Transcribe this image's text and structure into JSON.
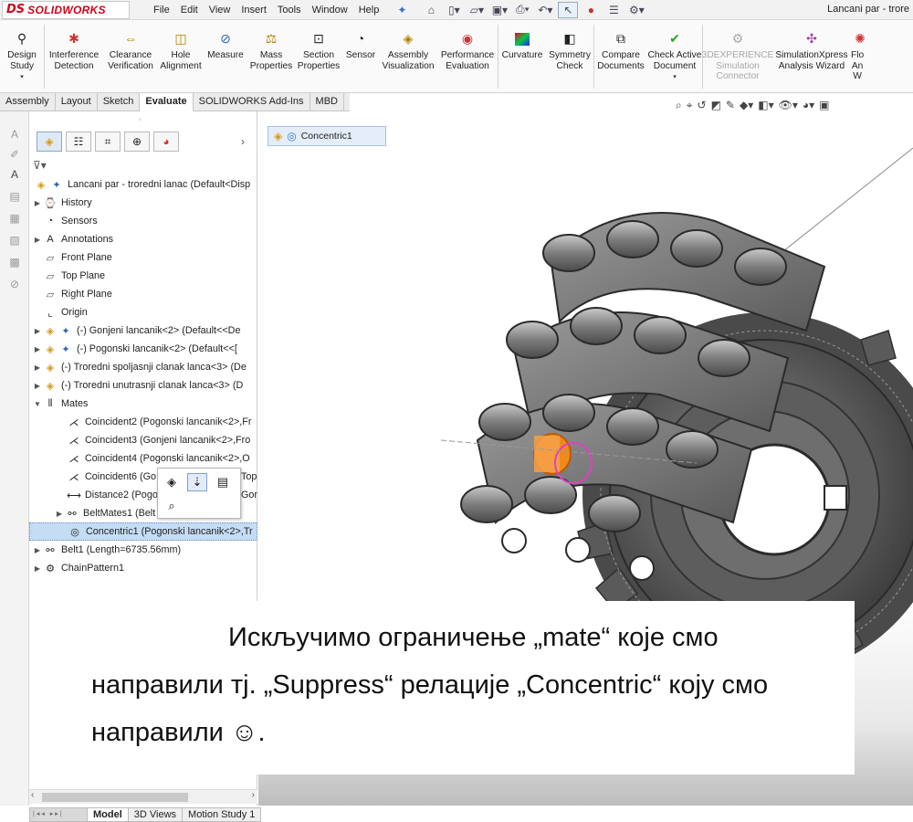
{
  "app": {
    "logo_ds": "DS",
    "logo_name": "SOLIDWORKS",
    "document_title": "Lancani par - trore"
  },
  "menu": [
    "File",
    "Edit",
    "View",
    "Insert",
    "Tools",
    "Window",
    "Help"
  ],
  "command_manager": [
    {
      "label": "Design Study",
      "icon": "design-study-icon",
      "has_dropdown": true
    },
    {
      "label": "Interference Detection",
      "icon": "interference-detection-icon"
    },
    {
      "label": "Clearance Verification",
      "icon": "clearance-verification-icon"
    },
    {
      "label": "Hole Alignment",
      "icon": "hole-alignment-icon"
    },
    {
      "label": "Measure",
      "icon": "measure-icon"
    },
    {
      "label": "Mass Properties",
      "icon": "mass-properties-icon"
    },
    {
      "label": "Section Properties",
      "icon": "section-properties-icon"
    },
    {
      "label": "Sensor",
      "icon": "sensor-icon"
    },
    {
      "label": "Assembly Visualization",
      "icon": "assembly-visualization-icon"
    },
    {
      "label": "Performance Evaluation",
      "icon": "performance-evaluation-icon"
    },
    {
      "label": "Curvature",
      "icon": "curvature-icon"
    },
    {
      "label": "Symmetry Check",
      "icon": "symmetry-check-icon"
    },
    {
      "label": "Compare Documents",
      "icon": "compare-documents-icon"
    },
    {
      "label": "Check Active Document",
      "icon": "check-active-document-icon",
      "has_dropdown": true
    },
    {
      "label": "3DEXPERIENCE Simulation Connector",
      "icon": "3dexperience-icon",
      "disabled": true
    },
    {
      "label": "SimulationXpress Analysis Wizard",
      "icon": "simulationxpress-icon"
    },
    {
      "label": "Flo An W",
      "icon": "flow-analysis-icon"
    }
  ],
  "command_tabs": [
    {
      "label": "Assembly"
    },
    {
      "label": "Layout"
    },
    {
      "label": "Sketch"
    },
    {
      "label": "Evaluate",
      "active": true
    },
    {
      "label": "SOLIDWORKS Add-Ins"
    },
    {
      "label": "MBD"
    }
  ],
  "feature_tree": {
    "root": "Lancani par - troredni lanac  (Default<Disp",
    "items": [
      {
        "label": "History",
        "icon": "history-icon",
        "expandable": true
      },
      {
        "label": "Sensors",
        "icon": "sensors-icon"
      },
      {
        "label": "Annotations",
        "icon": "annotations-icon",
        "expandable": true
      },
      {
        "label": "Front Plane",
        "icon": "plane-icon"
      },
      {
        "label": "Top Plane",
        "icon": "plane-icon"
      },
      {
        "label": "Right Plane",
        "icon": "plane-icon"
      },
      {
        "label": "Origin",
        "icon": "origin-icon"
      },
      {
        "label": "(-) Gonjeni lancanik<2> (Default<<De",
        "icon": "part-icon",
        "expandable": true
      },
      {
        "label": "(-) Pogonski lancanik<2> (Default<<[",
        "icon": "part-icon",
        "expandable": true
      },
      {
        "label": "(-) Troredni spoljasnji clanak lanca<3> (De",
        "icon": "part-icon",
        "expandable": true
      },
      {
        "label": "(-) Troredni unutrasnji clanak lanca<3> (D",
        "icon": "part-icon",
        "expandable": true
      },
      {
        "label": "Mates",
        "icon": "mates-icon",
        "expanded": true
      },
      {
        "label": "Coincident2 (Pogonski lancanik<2>,Fr",
        "icon": "coincident-icon",
        "indent": 1
      },
      {
        "label": "Coincident3 (Gonjeni lancanik<2>,Fro",
        "icon": "coincident-icon",
        "indent": 1
      },
      {
        "label": "Coincident4 (Pogonski lancanik<2>,O",
        "icon": "coincident-icon",
        "indent": 1
      },
      {
        "label": "Coincident6 (Go",
        "icon": "coincident-icon",
        "indent": 1,
        "tail": "Top"
      },
      {
        "label": "Distance2 (Pogo",
        "icon": "distance-icon",
        "indent": 1,
        "tail": "Gon"
      },
      {
        "label": "BeltMates1 (Belt",
        "icon": "beltmates-icon",
        "indent": 1,
        "expandable": true
      },
      {
        "label": "Concentric1 (Pogonski lancanik<2>,Tr",
        "icon": "concentric-icon",
        "indent": 1,
        "selected": true
      },
      {
        "label": "Belt1 (Length=6735.56mm)",
        "icon": "belt-icon",
        "expandable": true
      },
      {
        "label": "ChainPattern1",
        "icon": "chain-pattern-icon",
        "expandable": true
      }
    ]
  },
  "breadcrumb": {
    "label": "Concentric1"
  },
  "bottom_tabs": [
    {
      "label": "Model",
      "active": true
    },
    {
      "label": "3D Views"
    },
    {
      "label": "Motion Study 1"
    }
  ],
  "caption": {
    "text": "Искључимо ограничење „mate“ које смо направили тј.  „Suppress“ релације „Concentric“ коју смо направили ☺."
  },
  "colors": {
    "accent_red": "#d0021b",
    "selection_blue": "#c5dcf5",
    "mate_orange": "#f08a1c"
  }
}
